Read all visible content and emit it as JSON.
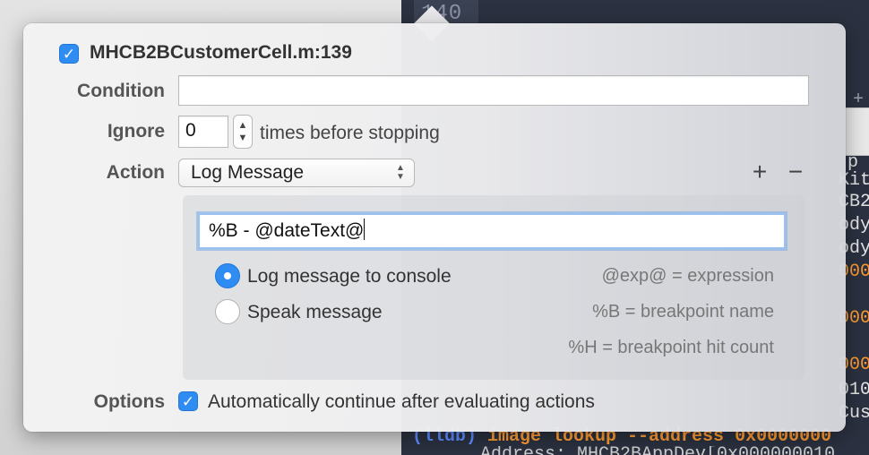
{
  "background": {
    "line_number": "140",
    "code_fragments": [
      {
        "text": "+",
        "style": "gray"
      },
      {
        "text": "p",
        "style": "normal"
      },
      {
        "text": "Kit",
        "style": "normal"
      },
      {
        "text": "CB2",
        "style": "normal"
      },
      {
        "text": "ody",
        "style": "normal"
      },
      {
        "text": "ody",
        "style": "normal"
      },
      {
        "text": "000",
        "style": "orange"
      },
      {
        "text": "000",
        "style": "orange"
      },
      {
        "text": "000",
        "style": "orange"
      },
      {
        "text": "010",
        "style": "normal"
      },
      {
        "text": "Cus",
        "style": "normal"
      }
    ],
    "lldb_prompt": "(lldb)",
    "lldb_command": " image lookup --address 0x0000000",
    "lldb_output": "Address: MHCB2BAppDev[0x000000010"
  },
  "breakpoint": {
    "enabled": true,
    "title": "MHCB2BCustomerCell.m:139",
    "condition_label": "Condition",
    "condition_value": "",
    "ignore_label": "Ignore",
    "ignore_value": "0",
    "ignore_suffix": "times before stopping",
    "action_label": "Action",
    "action_selected": "Log Message",
    "add_action": "+",
    "remove_action": "−",
    "message_value": "%B - @dateText@",
    "log_option": {
      "label": "Log message to console",
      "selected": true
    },
    "speak_option": {
      "label": "Speak message",
      "selected": false
    },
    "hints": [
      "@exp@ = expression",
      "%B = breakpoint name",
      "%H = breakpoint hit count"
    ],
    "options_label": "Options",
    "auto_continue": {
      "checked": true,
      "label": "Automatically continue after evaluating actions"
    }
  },
  "colors": {
    "accent": "#2F8CF2",
    "editor_bg": "#2B3140",
    "orange_number": "#FF9C33"
  }
}
